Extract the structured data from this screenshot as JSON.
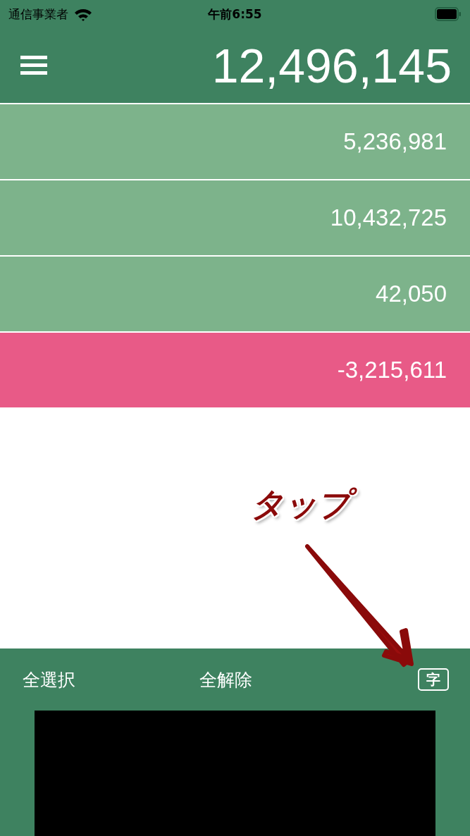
{
  "status_bar": {
    "carrier": "通信事業者",
    "time": "午前6:55"
  },
  "header": {
    "total": "12,496,145"
  },
  "rows": [
    {
      "amount": "5,236,981",
      "color": "#7db38b"
    },
    {
      "amount": "10,432,725",
      "color": "#7db38b"
    },
    {
      "amount": "42,050",
      "color": "#7db38b"
    },
    {
      "amount": "-3,215,611",
      "color": "#e85a87"
    }
  ],
  "toolbar": {
    "select_all": "全選択",
    "deselect_all": "全解除",
    "text_button": "字"
  },
  "annotation": {
    "label": "タップ"
  }
}
